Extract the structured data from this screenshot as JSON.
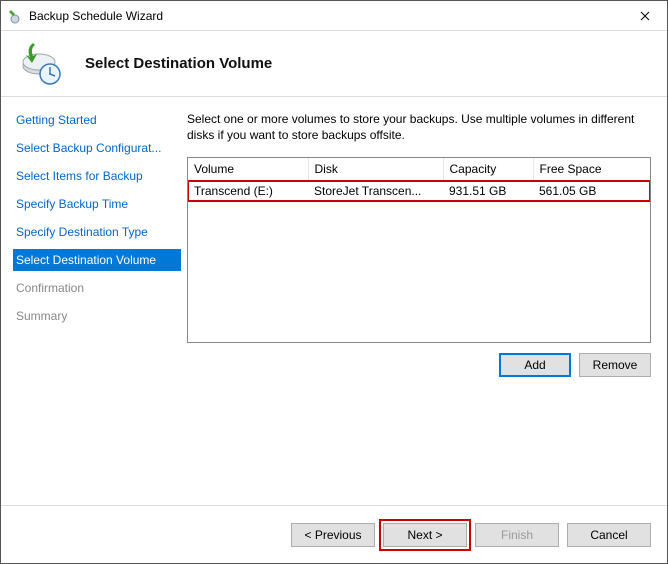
{
  "window": {
    "title": "Backup Schedule Wizard"
  },
  "header": {
    "title": "Select Destination Volume"
  },
  "sidebar": {
    "steps": [
      {
        "label": "Getting Started",
        "state": "done"
      },
      {
        "label": "Select Backup Configurat...",
        "state": "done"
      },
      {
        "label": "Select Items for Backup",
        "state": "done"
      },
      {
        "label": "Specify Backup Time",
        "state": "done"
      },
      {
        "label": "Specify Destination Type",
        "state": "done"
      },
      {
        "label": "Select Destination Volume",
        "state": "active"
      },
      {
        "label": "Confirmation",
        "state": "inactive"
      },
      {
        "label": "Summary",
        "state": "inactive"
      }
    ]
  },
  "main": {
    "instructions": "Select one or more volumes to store your backups. Use multiple volumes in different disks if you want to store backups offsite.",
    "table": {
      "columns": [
        "Volume",
        "Disk",
        "Capacity",
        "Free Space"
      ],
      "rows": [
        {
          "volume": "Transcend (E:)",
          "disk": "StoreJet Transcen...",
          "capacity": "931.51 GB",
          "free": "561.05 GB",
          "highlight": true
        }
      ]
    },
    "buttons": {
      "add": "Add",
      "remove": "Remove"
    }
  },
  "footer": {
    "previous": "< Previous",
    "next": "Next >",
    "finish": "Finish",
    "cancel": "Cancel"
  }
}
